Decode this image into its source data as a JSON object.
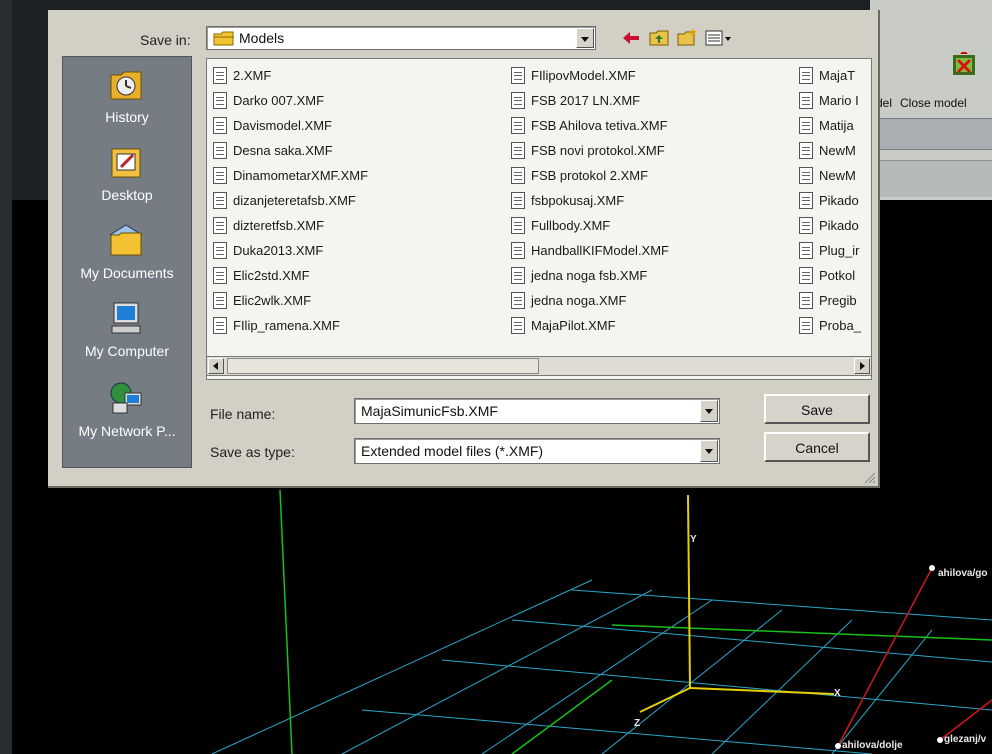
{
  "toolbar": {
    "left_fragment": "del",
    "close_model_label": "Close model"
  },
  "dialog": {
    "save_in_label": "Save in:",
    "save_in_value": "Models",
    "places": [
      {
        "label": "History",
        "icon": "history-icon"
      },
      {
        "label": "Desktop",
        "icon": "desktop-icon"
      },
      {
        "label": "My Documents",
        "icon": "my-documents-icon"
      },
      {
        "label": "My Computer",
        "icon": "my-computer-icon"
      },
      {
        "label": "My Network P...",
        "icon": "network-places-icon"
      }
    ],
    "files_col1": [
      "2.XMF",
      "Darko 007.XMF",
      "Davismodel.XMF",
      "Desna saka.XMF",
      "DinamometarXMF.XMF",
      "dizanjeteretafsb.XMF",
      "dizteretfsb.XMF",
      "Duka2013.XMF",
      "Elic2std.XMF",
      "Elic2wlk.XMF",
      "FIlip_ramena.XMF"
    ],
    "files_col2": [
      "FIlipovModel.XMF",
      "FSB 2017 LN.XMF",
      "FSB Ahilova tetiva.XMF",
      "FSB novi protokol.XMF",
      "FSB protokol 2.XMF",
      "fsbpokusaj.XMF",
      "Fullbody.XMF",
      "HandballKIFModel.XMF",
      "jedna noga fsb.XMF",
      "jedna noga.XMF",
      "MajaPilot.XMF"
    ],
    "files_col3": [
      "MajaT",
      "Mario I",
      "Matija",
      "NewM",
      "NewM",
      "Pikado",
      "Pikado",
      "Plug_ir",
      "Potkol",
      "Pregib",
      "Proba_"
    ],
    "file_name_label": "File name:",
    "file_name_value": "MajaSimunicFsb.XMF",
    "save_as_type_label": "Save as type:",
    "save_as_type_value": "Extended model files (*.XMF)",
    "save_button": "Save",
    "cancel_button": "Cancel"
  },
  "viewport": {
    "axis_y": "Y",
    "axis_x": "X",
    "axis_z": "Z",
    "marker_1": "ahilova/go",
    "marker_2": "ahilova/dolje",
    "marker_3": "glezanj/v"
  }
}
